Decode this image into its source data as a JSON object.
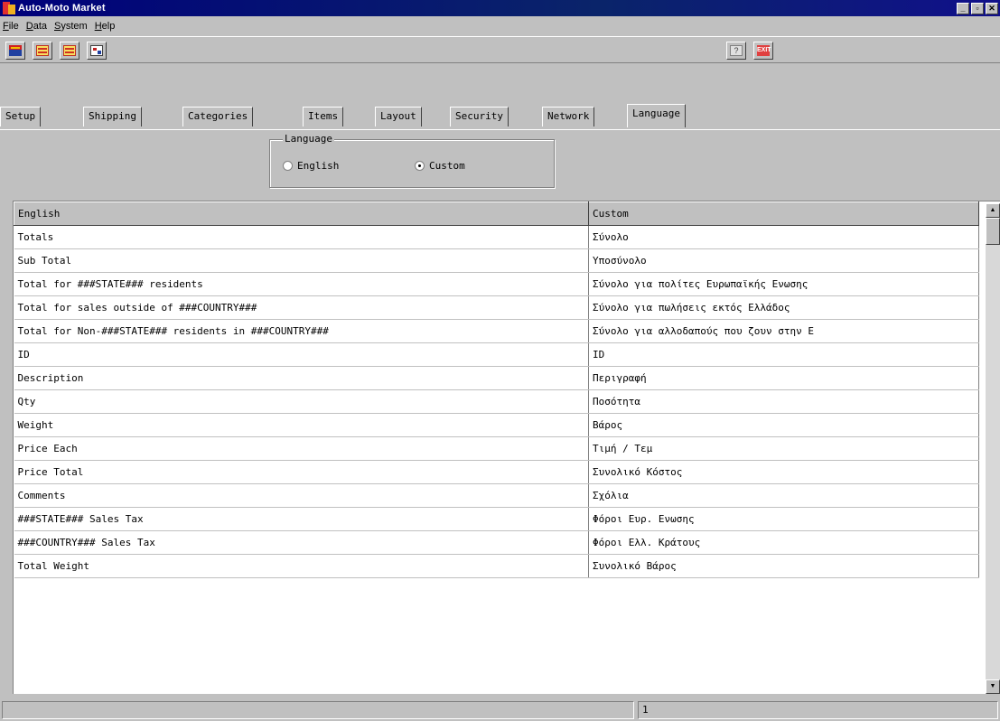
{
  "window": {
    "title": "Auto-Moto Market"
  },
  "menu": [
    "File",
    "Data",
    "System",
    "Help"
  ],
  "toolbar": {
    "left_icons": [
      "car-icon",
      "calendar-icon",
      "calendar-icon",
      "grid-icon"
    ],
    "right_icons": [
      "help-icon",
      "exit-icon"
    ],
    "exit_label": "EXIT"
  },
  "tabs": [
    "Setup",
    "Shipping",
    "Categories",
    "Items",
    "Layout",
    "Security",
    "Network",
    "Language"
  ],
  "active_tab": "Language",
  "language_group": {
    "label": "Language",
    "options": [
      "English",
      "Custom"
    ],
    "selected": "Custom"
  },
  "grid": {
    "columns": [
      "English",
      "Custom"
    ],
    "rows": [
      [
        "Totals",
        "Σύνολο"
      ],
      [
        "Sub Total",
        "Υποσύνολο"
      ],
      [
        "Total for ###STATE### residents",
        "Σύνολο για πολίτες Ευρωπαϊκής Ενωσης"
      ],
      [
        "Total for sales outside of ###COUNTRY###",
        "Σύνολο για πωλήσεις εκτός Ελλάδος"
      ],
      [
        "Total for Non-###STATE### residents in ###COUNTRY###",
        "Σύνολο για αλλοδαπούς που ζουν στην Ε"
      ],
      [
        "ID",
        "ID"
      ],
      [
        "Description",
        "Περιγραφή"
      ],
      [
        "Qty",
        "Ποσότητα"
      ],
      [
        "Weight",
        "Βάρος"
      ],
      [
        "Price Each",
        "Τιμή / Τεμ"
      ],
      [
        "Price Total",
        "Συνολικό Κόστος"
      ],
      [
        "Comments",
        "Σχόλια"
      ],
      [
        "###STATE### Sales Tax",
        "Φόροι Ευρ. Ενωσης"
      ],
      [
        "###COUNTRY### Sales Tax",
        "Φόροι Ελλ. Κράτους"
      ],
      [
        "Total Weight",
        "Συνολικό Βάρος"
      ]
    ]
  },
  "status": {
    "page": "1"
  }
}
